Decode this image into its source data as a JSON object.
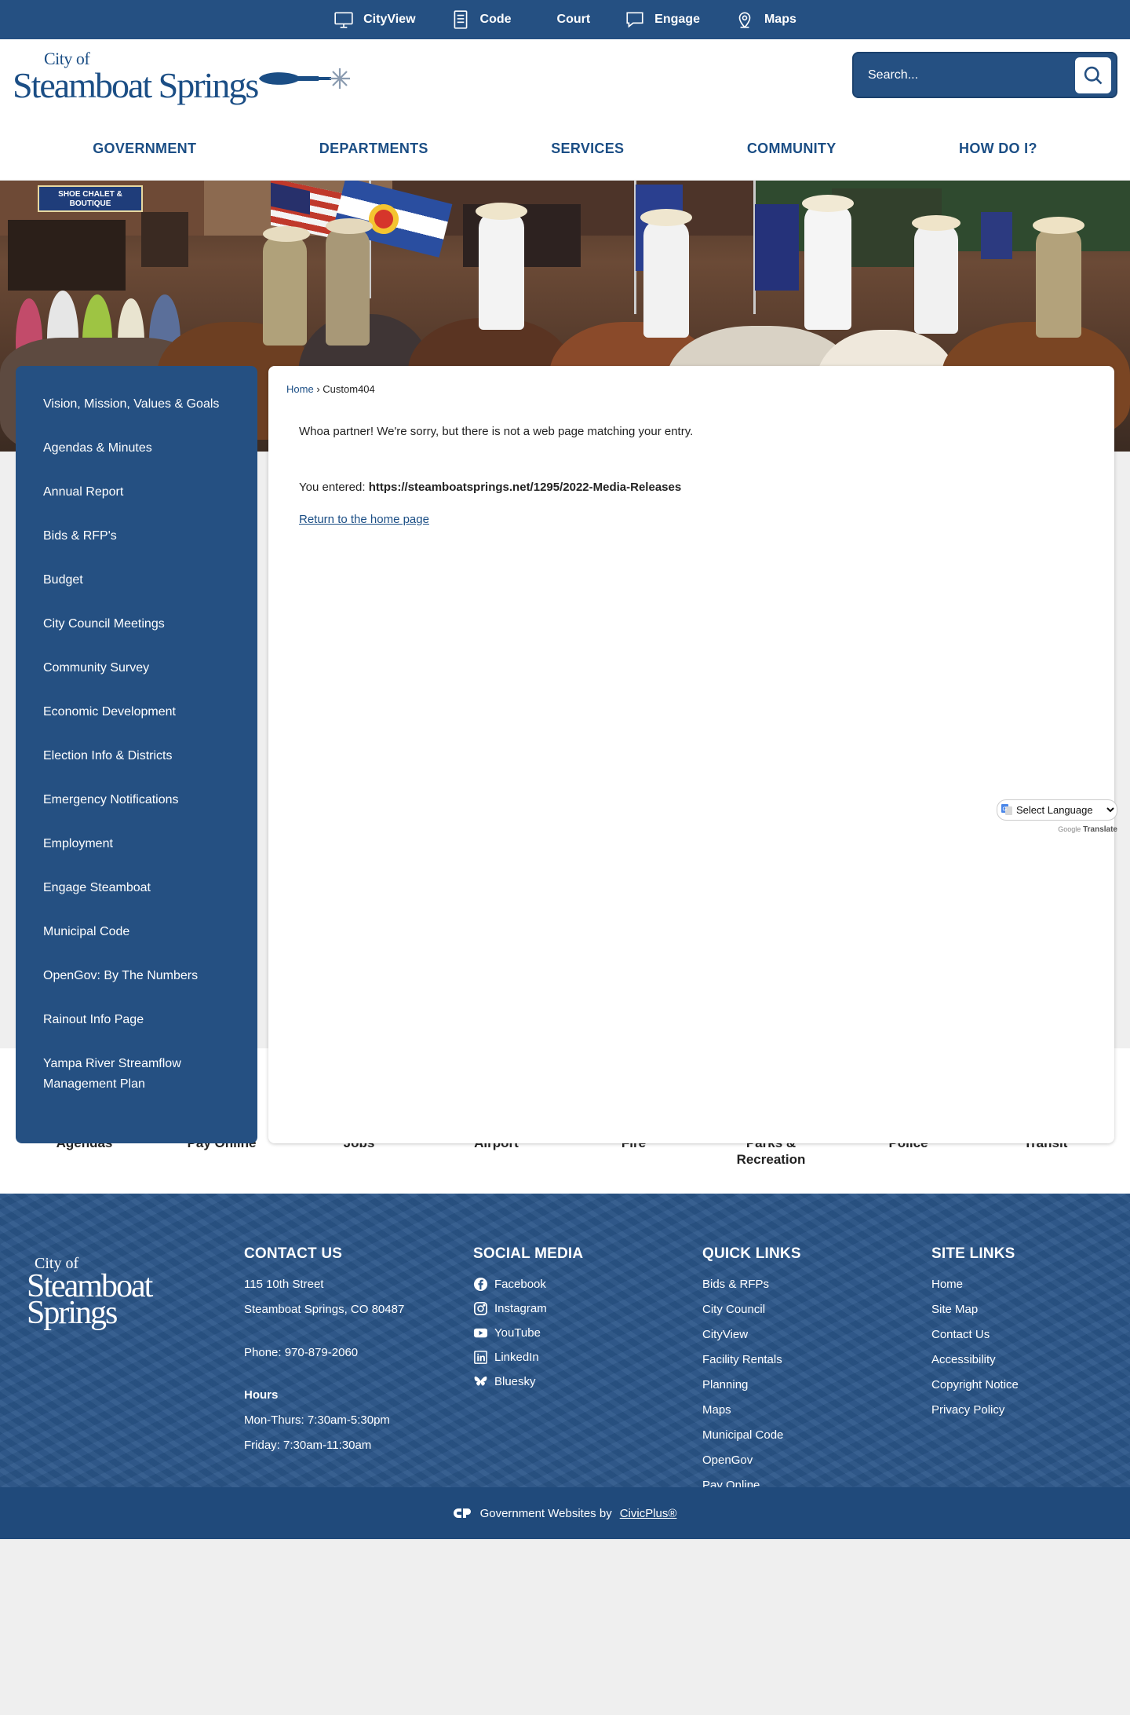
{
  "topbar": {
    "links": [
      {
        "label": "CityView",
        "icon": "monitor-icon"
      },
      {
        "label": "Code",
        "icon": "document-icon"
      },
      {
        "label": "Court",
        "icon": ""
      },
      {
        "label": "Engage",
        "icon": "chat-bubble-icon"
      },
      {
        "label": "Maps",
        "icon": "map-pin-icon"
      }
    ]
  },
  "header": {
    "logo_city_of": "City of",
    "logo_name": "Steamboat Springs",
    "search_placeholder": "Search..."
  },
  "mainnav": [
    "GOVERNMENT",
    "DEPARTMENTS",
    "SERVICES",
    "COMMUNITY",
    "HOW DO I?"
  ],
  "sidenav": [
    "Vision, Mission, Values & Goals",
    "Agendas & Minutes",
    "Annual Report",
    "Bids & RFP's",
    "Budget",
    "City Council Meetings",
    "Community Survey",
    "Economic Development",
    "Election Info & Districts",
    "Emergency Notifications",
    "Employment",
    "Engage Steamboat",
    "Municipal Code",
    "OpenGov: By The Numbers",
    "Rainout Info Page",
    "Yampa River Streamflow Management Plan"
  ],
  "content": {
    "breadcrumb_home": "Home",
    "breadcrumb_sep": "›",
    "breadcrumb_current": "Custom404",
    "message": "Whoa partner! We're sorry, but there is not a web page matching your entry.",
    "entered_label": "You entered:",
    "entered_url": "https://steamboatsprings.net/1295/2022-Media-Releases",
    "return_link": "Return to the home page"
  },
  "translate": {
    "select_label": "Select Language",
    "powered_google": "Google",
    "powered_translate": "Translate"
  },
  "hero": {
    "sign_text": "SHOE CHALET & BOUTIQUE"
  },
  "quicklinks": [
    {
      "label": "Agendas",
      "icon": "agenda-icon"
    },
    {
      "label": "Pay Online",
      "icon": "payment-cards-icon"
    },
    {
      "label": "Jobs",
      "icon": "briefcase-icon"
    },
    {
      "label": "Airport",
      "icon": "airplane-icon"
    },
    {
      "label": "Fire",
      "icon": "flame-icon"
    },
    {
      "label": "Parks & Recreation",
      "icon": "signpost-icon"
    },
    {
      "label": "Police",
      "icon": "badge-star-icon"
    },
    {
      "label": "Transit",
      "icon": "bus-icon"
    }
  ],
  "footer": {
    "logo_city_of": "City of",
    "logo_line1": "Steamboat",
    "logo_line2": "Springs",
    "contact": {
      "title": "CONTACT US",
      "address1": "115 10th Street",
      "address2": "Steamboat Springs, CO 80487",
      "phone": "Phone: 970-879-2060",
      "hours_title": "Hours",
      "hours1": "Mon-Thurs: 7:30am-5:30pm",
      "hours2": "Friday: 7:30am-11:30am"
    },
    "social": {
      "title": "SOCIAL MEDIA",
      "items": [
        {
          "label": "Facebook",
          "icon": "facebook-icon"
        },
        {
          "label": "Instagram",
          "icon": "instagram-icon"
        },
        {
          "label": "YouTube",
          "icon": "youtube-icon"
        },
        {
          "label": "LinkedIn",
          "icon": "linkedin-icon"
        },
        {
          "label": "Bluesky",
          "icon": "bluesky-icon"
        }
      ]
    },
    "quick": {
      "title": "QUICK LINKS",
      "items": [
        "Bids & RFPs",
        "City Council",
        "CityView",
        "Facility Rentals",
        "Planning",
        "Maps",
        "Municipal Code",
        "OpenGov",
        "Pay Online"
      ]
    },
    "site": {
      "title": "SITE LINKS",
      "items": [
        "Home",
        "Site Map",
        "Contact Us",
        "Accessibility",
        "Copyright Notice",
        "Privacy Policy"
      ]
    },
    "bottom_text": "Government Websites by",
    "bottom_link": "CivicPlus®"
  },
  "colors": {
    "primary": "#255082",
    "link": "#1b4e85",
    "footer": "#2a5588"
  }
}
